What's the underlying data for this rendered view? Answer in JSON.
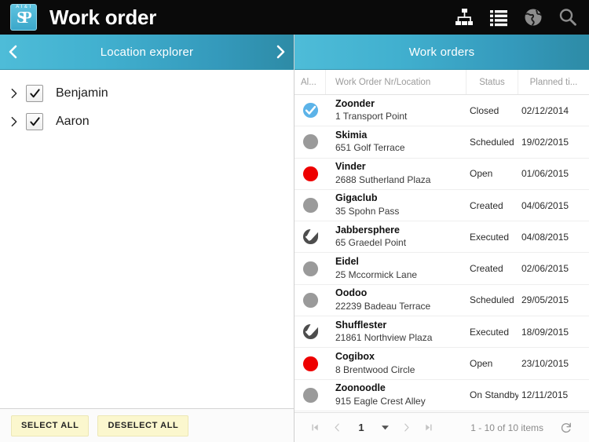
{
  "topbar": {
    "title": "Work order",
    "logo_text": "SP",
    "logo_tagline": "A I & I",
    "icons": [
      {
        "name": "hierarchy-icon",
        "label": "Hierarchy",
        "color": "#ffffff"
      },
      {
        "name": "list-icon",
        "label": "List",
        "color": "#ffffff"
      },
      {
        "name": "globe-icon",
        "label": "Globe",
        "color": "#8d8d8d"
      },
      {
        "name": "search-icon",
        "label": "Search",
        "color": "#8d8d8d"
      }
    ],
    "background": "#0a0a0a"
  },
  "left_panel": {
    "header": {
      "title": "Location explorer",
      "prev_label": "‹",
      "next_label": "›"
    },
    "tree_items": [
      {
        "label": "Benjamin",
        "checked": true,
        "expanded": false
      },
      {
        "label": "Aaron",
        "checked": true,
        "expanded": false
      }
    ],
    "footer": {
      "select_all": "SELECT ALL",
      "deselect_all": "DESELECT ALL",
      "button_bg": "#fbf7ce"
    }
  },
  "right_panel": {
    "header": {
      "title": "Work orders"
    },
    "columns": [
      {
        "key": "alert",
        "label": "Al..."
      },
      {
        "key": "name",
        "label": "Work Order Nr/Location"
      },
      {
        "key": "status",
        "label": "Status"
      },
      {
        "key": "date",
        "label": "Planned ti..."
      }
    ],
    "rows": [
      {
        "icon": "closed",
        "name": "Zoonder",
        "location": "1 Transport Point",
        "status": "Closed",
        "date": "02/12/2014"
      },
      {
        "icon": "gray",
        "name": "Skimia",
        "location": "651 Golf Terrace",
        "status": "Scheduled",
        "date": "19/02/2015"
      },
      {
        "icon": "red",
        "name": "Vinder",
        "location": "2688 Sutherland Plaza",
        "status": "Open",
        "date": "01/06/2015"
      },
      {
        "icon": "gray",
        "name": "Gigaclub",
        "location": "35 Spohn Pass",
        "status": "Created",
        "date": "04/06/2015"
      },
      {
        "icon": "dark",
        "name": "Jabbersphere",
        "location": "65 Graedel Point",
        "status": "Executed",
        "date": "04/08/2015"
      },
      {
        "icon": "gray",
        "name": "Eidel",
        "location": "25 Mccormick Lane",
        "status": "Created",
        "date": "02/06/2015"
      },
      {
        "icon": "gray",
        "name": "Oodoo",
        "location": "22239 Badeau Terrace",
        "status": "Scheduled",
        "date": "29/05/2015"
      },
      {
        "icon": "dark",
        "name": "Shufflester",
        "location": "21861 Northview Plaza",
        "status": "Executed",
        "date": "18/09/2015"
      },
      {
        "icon": "red",
        "name": "Cogibox",
        "location": "8 Brentwood Circle",
        "status": "Open",
        "date": "23/10/2015"
      },
      {
        "icon": "gray",
        "name": "Zoonoodle",
        "location": "915 Eagle Crest Alley",
        "status": "On Standby",
        "date": "12/11/2015"
      }
    ],
    "pager": {
      "first_label": "⏮",
      "prev_label": "‹",
      "page": "1",
      "next_label": "›",
      "last_label": "⏭",
      "info": "1 - 10 of 10 items",
      "refresh_label": "↻"
    }
  },
  "colors": {
    "accent_teal_light": "#4ebcd8",
    "accent_teal_dark": "#2d8ba6",
    "status_closed_blue": "#5cb3e8",
    "status_open_red": "#ee0000",
    "status_gray": "#9a9a9a",
    "status_dark": "#4d4d4d"
  }
}
